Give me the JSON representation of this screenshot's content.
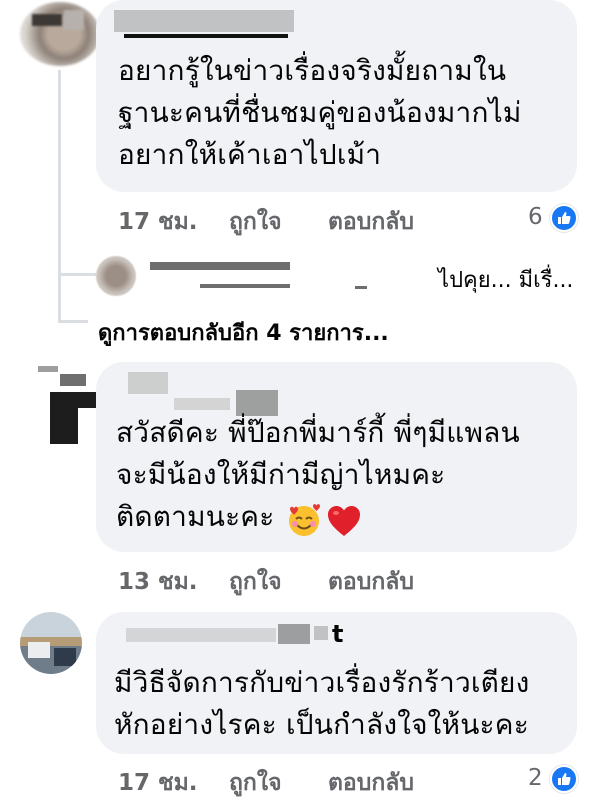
{
  "comment1": {
    "author": "",
    "text": "อยากรู้ในข่าวเรื่องจริงมั้ยถามใน\nฐานะคนที่ชื่นชมคู่ของน้องมากไม่\nอยากให้เค้าเอาไปเม้า",
    "time": "17 ชม.",
    "like_label": "ถูกใจ",
    "reply_label": "ตอบกลับ",
    "like_count": "6"
  },
  "reply_preview": {
    "text": "ไปคุย... มีเรื่...",
    "view_more": "ดูการตอบกลับอีก 4 รายการ..."
  },
  "comment2": {
    "author": "",
    "text": "สวัสดีคะ พี่ป๊อกพี่มาร์กี้ พี่ๆมีแพลน\nจะมีน้องให้มีก่ามีญ่าไหมคะ\nติดตามนะคะ",
    "emojis": [
      "smiling-face-with-hearts",
      "red-heart"
    ],
    "time": "13 ชม.",
    "like_label": "ถูกใจ",
    "reply_label": "ตอบกลับ"
  },
  "comment3": {
    "author": "t",
    "text": "มีวิธีจัดการกับข่าวเรื่องรักร้าวเตียง\nหักอย่างไรคะ เป็นกำลังใจให้นะคะ",
    "time": "17 ชม.",
    "like_label": "ถูกใจ",
    "reply_label": "ตอบกลับ",
    "like_count": "2"
  },
  "colors": {
    "bubble": "#f0f2f5",
    "meta_text": "#65676b",
    "like_blue": "#1877f2"
  }
}
